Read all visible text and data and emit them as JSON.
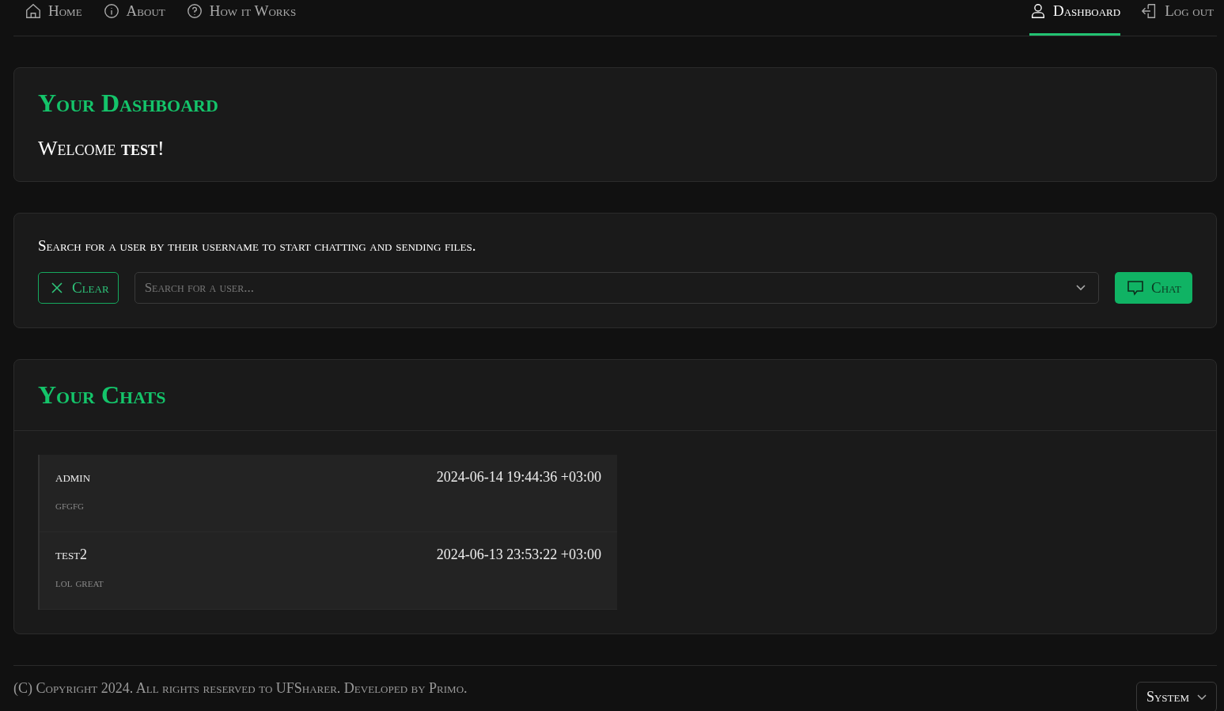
{
  "nav": {
    "left": [
      {
        "label": "Home",
        "kind": "home",
        "selected": false
      },
      {
        "label": "About",
        "kind": "info",
        "selected": false
      },
      {
        "label": "How it Works",
        "kind": "help",
        "selected": false
      }
    ],
    "right": [
      {
        "label": "Dashboard",
        "kind": "user",
        "selected": true
      },
      {
        "label": "Log out",
        "kind": "logout",
        "selected": false
      }
    ]
  },
  "welcome_card": {
    "title": "Your Dashboard",
    "greeting": "Welcome **test**!"
  },
  "search_card": {
    "instructions": "Search for a user by their username to start chatting and sending files.",
    "clear_button": "Clear",
    "search": {
      "placeholder": "Search for a user..."
    },
    "chat_button": "Chat"
  },
  "chats_card": {
    "title": "Your Chats",
    "chats": [
      {
        "user": "admin",
        "message": "gfgfg",
        "time": "2024-06-14 19:44:36 +03:00"
      },
      {
        "user": "test2",
        "message": "lol great",
        "time": "2024-06-13 23:53:22 +03:00"
      }
    ]
  },
  "footer": {
    "copyright": "(C) Copyright 2024. All rights reserved to UFSharer. Developed by Primo.",
    "theme_select": "System"
  }
}
